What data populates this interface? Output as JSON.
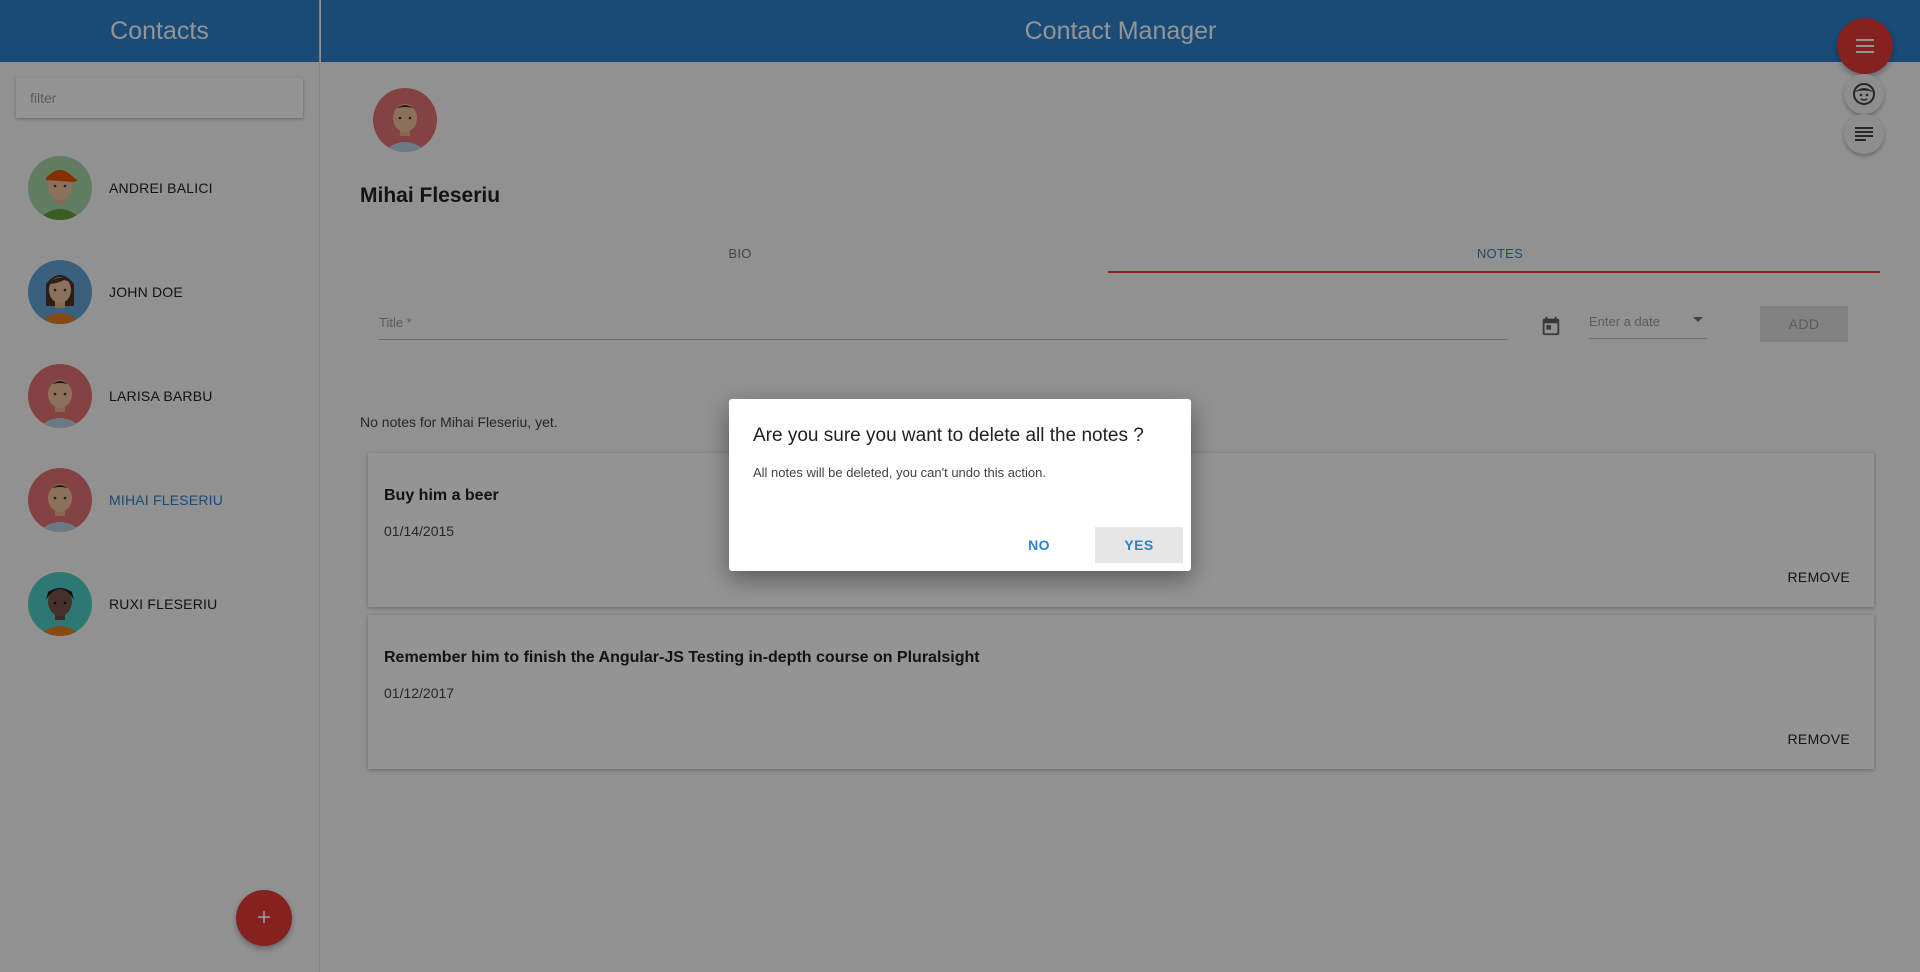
{
  "sidebar": {
    "title": "Contacts",
    "filter_placeholder": "filter",
    "contacts": [
      {
        "name": "ANDREI BALICI",
        "active": false,
        "avatar": "avatar-green-cap"
      },
      {
        "name": "JOHN DOE",
        "active": false,
        "avatar": "avatar-blue-woman"
      },
      {
        "name": "LARISA BARBU",
        "active": false,
        "avatar": "avatar-red-man"
      },
      {
        "name": "MIHAI FLESERIU",
        "active": true,
        "avatar": "avatar-red-man"
      },
      {
        "name": "RUXI FLESERIU",
        "active": false,
        "avatar": "avatar-teal-woman"
      }
    ],
    "add_label": "+"
  },
  "main": {
    "title": "Contact Manager",
    "contact_name": "Mihai Fleseriu",
    "tabs": [
      {
        "label": "BIO",
        "active": false
      },
      {
        "label": "NOTES",
        "active": true
      }
    ],
    "form": {
      "title_placeholder": "Title *",
      "date_placeholder": "Enter a date",
      "add_label": "ADD"
    },
    "no_notes_text": "No notes for Mihai Fleseriu, yet.",
    "notes": [
      {
        "title": "Buy him a beer",
        "date": "01/14/2015",
        "remove_label": "REMOVE"
      },
      {
        "title": "Remember him to finish the Angular-JS Testing in-depth course on Pluralsight",
        "date": "01/12/2017",
        "remove_label": "REMOVE"
      }
    ]
  },
  "dialog": {
    "title": "Are you sure you want to delete all the notes ?",
    "text": "All notes will be deleted, you can't undo this action.",
    "no_label": "NO",
    "yes_label": "YES"
  },
  "colors": {
    "primary": "#2b82cc",
    "accent": "#e53935"
  },
  "icons": {
    "menu": "menu-icon",
    "avatar": "face-icon",
    "notes": "notes-icon",
    "calendar": "calendar-icon"
  }
}
